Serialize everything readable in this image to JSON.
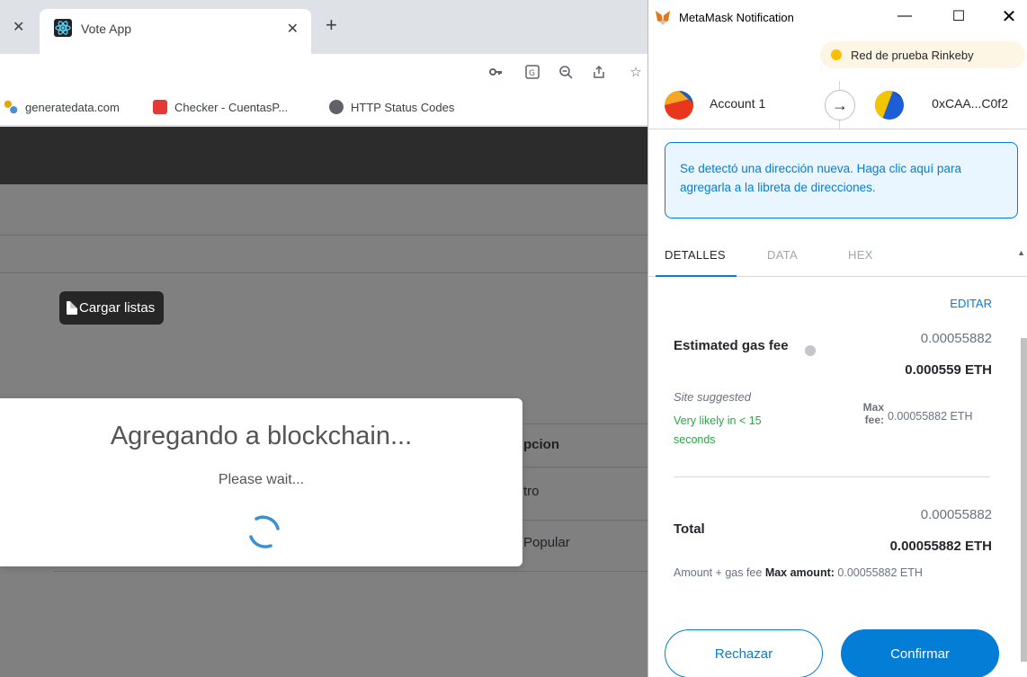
{
  "browser": {
    "tab_title": "Vote App",
    "bookmarks": [
      "generatedata.com",
      "Checker - CuentasP...",
      "HTTP Status Codes"
    ]
  },
  "page": {
    "load_button": "Cargar listas",
    "table_header": "pcion",
    "table_rows": [
      "tro",
      "Popular"
    ]
  },
  "modal": {
    "title": "Agregando a blockchain...",
    "subtitle": "Please wait..."
  },
  "metamask": {
    "window_title": "MetaMask Notification",
    "network": "Red de prueba Rinkeby",
    "account_name": "Account 1",
    "to_address": "0xCAA...C0f2",
    "notice": "Se detectó una dirección nueva. Haga clic aquí para agregarla a la libreta de direcciones.",
    "tabs": [
      "DETALLES",
      "DATA",
      "HEX"
    ],
    "edit_label": "EDITAR",
    "gas_label": "Estimated gas fee",
    "gas_fiat": "0.00055882",
    "gas_eth": "0.000559 ETH",
    "site_suggested": "Site suggested",
    "likelihood": "Very likely in < 15 seconds",
    "max_fee_label": "Max fee:",
    "max_fee_value": "0.00055882 ETH",
    "total_label": "Total",
    "total_fiat": "0.00055882",
    "total_eth": "0.00055882 ETH",
    "amount_label": "Amount + gas fee",
    "max_amount_label": "Max amount:",
    "max_amount_value": "0.00055882 ETH",
    "reject_label": "Rechazar",
    "confirm_label": "Confirmar"
  },
  "colors": {
    "accent": "#037dd6",
    "success": "#28a745",
    "overlay": "#808080"
  }
}
